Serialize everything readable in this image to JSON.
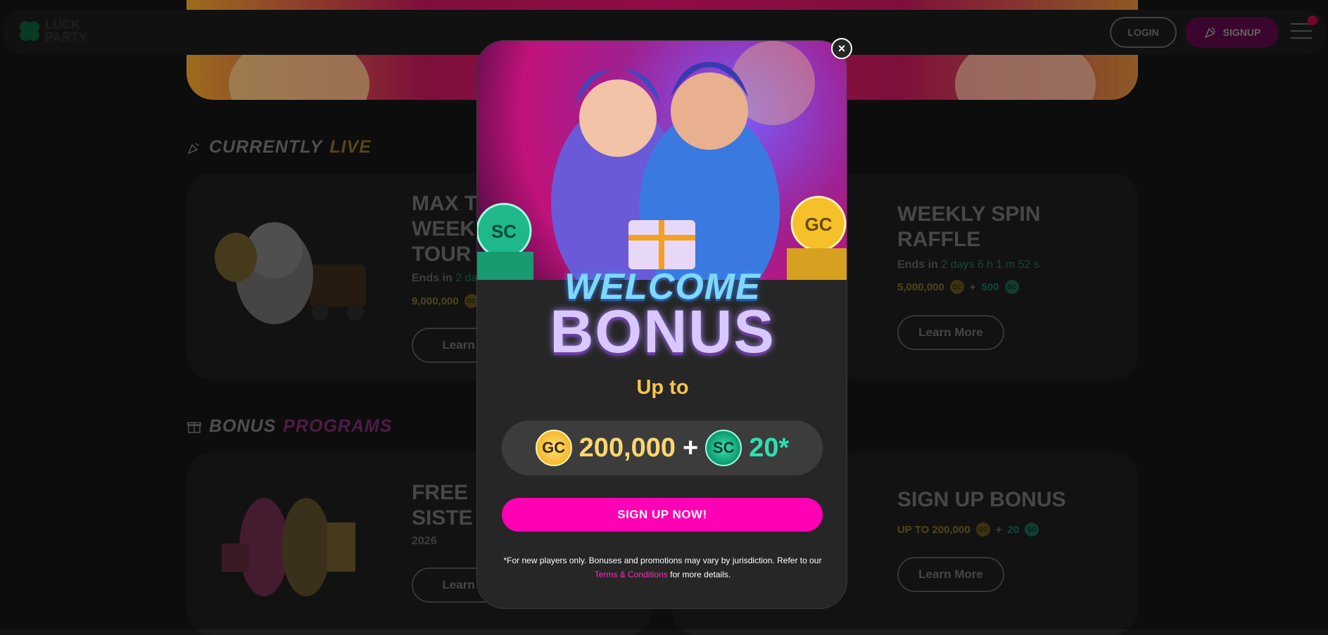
{
  "brand": {
    "line1": "LUCK",
    "line2": "PARTY"
  },
  "header": {
    "login_label": "LOGIN",
    "signup_label": "SIGNUP"
  },
  "sections": {
    "live": {
      "word1": "CURRENTLY",
      "word2": "LIVE"
    },
    "bonus": {
      "word1": "BONUS",
      "word2": "PROGRAMS"
    }
  },
  "live_cards": [
    {
      "title_lines": [
        "MAX T",
        "WEEK",
        "TOUR"
      ],
      "ends_label": "Ends in",
      "ends_value": "2 da",
      "gc_amount": "9,000,000",
      "learn_label": "Learn M"
    },
    {
      "title_lines": [
        "WEEKLY SPIN",
        "RAFFLE"
      ],
      "ends_label": "Ends in",
      "ends_value": "2 days 6 h 1 m 52 s",
      "gc_amount": "5,000,000",
      "plus": "+",
      "sc_amount": "500",
      "learn_label": "Learn More"
    }
  ],
  "bonus_cards": [
    {
      "title_lines": [
        "FREE",
        "SISTE"
      ],
      "sub": "2026",
      "learn_label": "Learn M"
    },
    {
      "title_lines": [
        "SIGN UP BONUS"
      ],
      "gc_amount": "UP TO 200,000",
      "plus": "+",
      "sc_amount": "20",
      "learn_label": "Learn More"
    }
  ],
  "coins": {
    "gc": "GC",
    "sc": "SC"
  },
  "modal": {
    "welcome_line1": "WELCOME",
    "welcome_line2": "BONUS",
    "up_to": "Up to",
    "gc_amount": "200,000",
    "plus": "+",
    "sc_amount": "20*",
    "cta_label": "SIGN UP NOW!",
    "disclaimer_text": "*For new players only. Bonuses and promotions may vary by jurisdiction. Refer to our",
    "terms_link": "Terms & Conditions",
    "disclaimer_tail": "for more details.",
    "close_symbol": "×"
  },
  "colors": {
    "accent_pink": "#ff00b4",
    "gold": "#fcd670",
    "teal": "#2ee0b0",
    "background": "#141414"
  },
  "icons": [
    "clover-icon",
    "party-popper-icon",
    "gift-icon",
    "hamburger-menu-icon",
    "close-icon",
    "gc-coin-icon",
    "sc-coin-icon"
  ]
}
